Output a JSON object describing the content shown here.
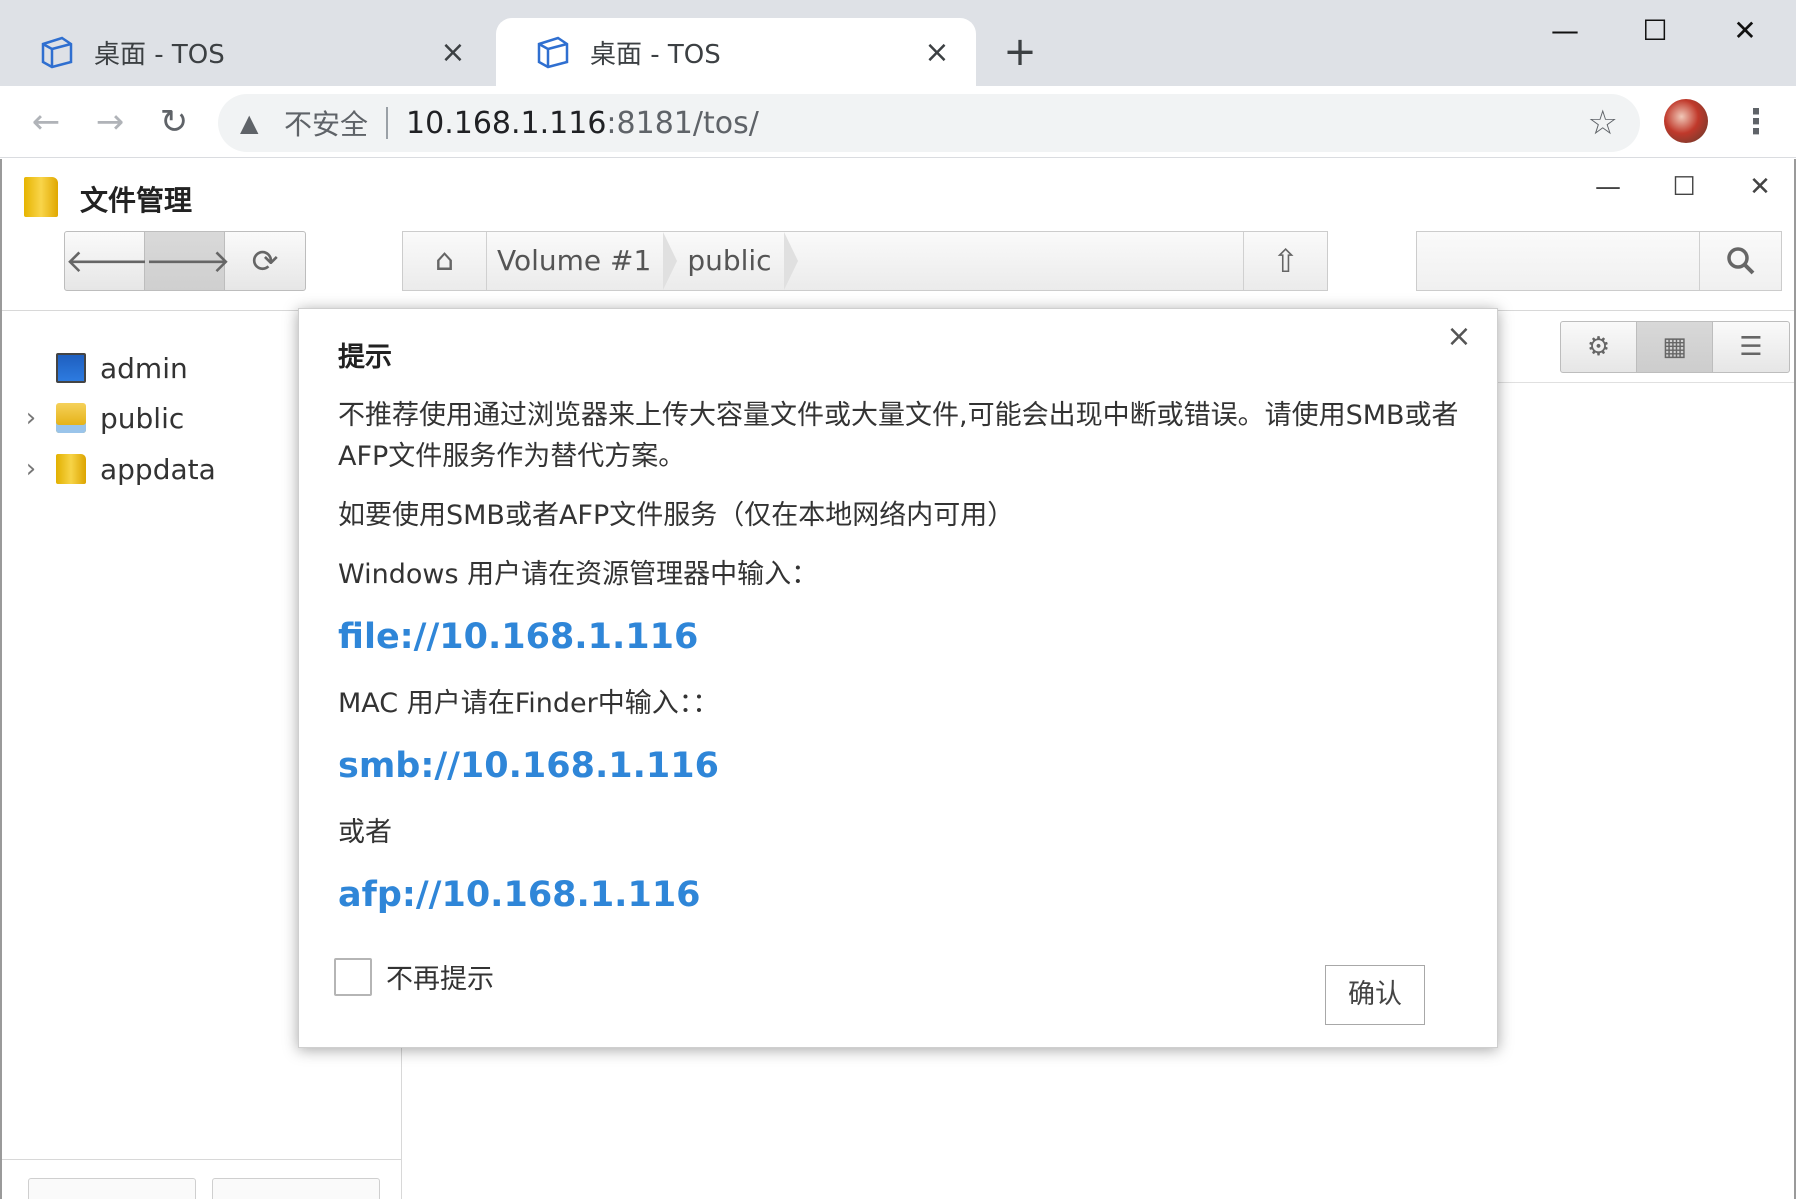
{
  "browser": {
    "tabs": [
      {
        "title": "桌面 - TOS",
        "close": "×"
      },
      {
        "title": "桌面 - TOS",
        "close": "×"
      }
    ],
    "new_tab": "+",
    "window_controls": {
      "minimize": "—",
      "maximize": "☐",
      "close": "✕"
    },
    "nav": {
      "back": "←",
      "forward": "→",
      "reload": "↻"
    },
    "omnibox": {
      "security_label": "不安全",
      "url_host": "10.168.1.116",
      "url_rest": ":8181/tos/"
    }
  },
  "app": {
    "title": "文件管理",
    "window_controls": {
      "minimize": "—",
      "maximize": "☐",
      "close": "✕"
    },
    "nav_buttons": {
      "back": "🡐",
      "forward": "🡒",
      "refresh": "⟳"
    },
    "breadcrumb": [
      "Volume #1",
      "public"
    ],
    "search": {
      "placeholder": "",
      "button": "🔍"
    },
    "sidebar": {
      "items": [
        {
          "label": "admin",
          "icon": "computer-icon",
          "expandable": false
        },
        {
          "label": "public",
          "icon": "shared-folder-icon",
          "expandable": true
        },
        {
          "label": "appdata",
          "icon": "folder-icon",
          "expandable": true
        }
      ]
    },
    "view_buttons": {
      "settings": "⚙",
      "grid": "▦",
      "list": "☰"
    }
  },
  "dialog": {
    "title": "提示",
    "close": "×",
    "paragraph1": "不推荐使用通过浏览器来上传大容量文件或大量文件,可能会出现中断或错误。请使用SMB或者AFP文件服务作为替代方案。",
    "paragraph2": "如要使用SMB或者AFP文件服务（仅在本地网络内可用）",
    "windows_hint": "Windows 用户请在资源管理器中输入：",
    "windows_link": "file://10.168.1.116",
    "mac_hint": "MAC 用户请在Finder中输入：：",
    "smb_link": "smb://10.168.1.116",
    "or_label": "或者",
    "afp_link": "afp://10.168.1.116",
    "checkbox_label": "不再提示",
    "checkbox_checked": false,
    "confirm_button": "确认",
    "link_color": "#2f86d8"
  }
}
